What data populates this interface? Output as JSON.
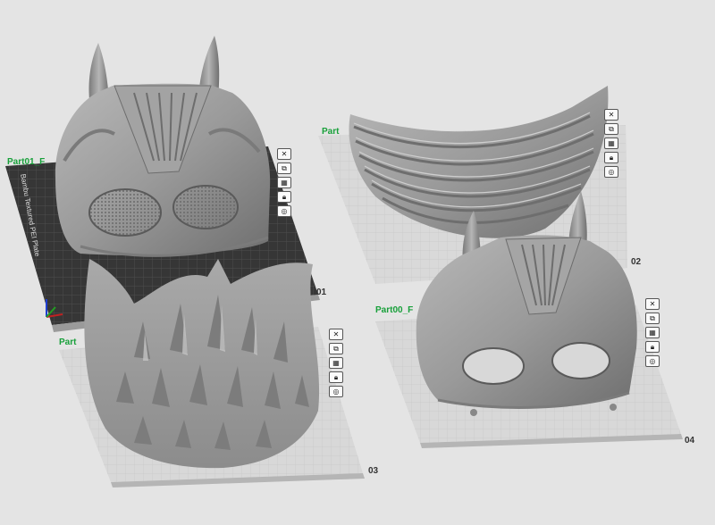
{
  "plates": [
    {
      "id": "plate-1",
      "label": "Part01_F",
      "number": "01",
      "side_text": "Bambu Textured PEI Plate",
      "icons": [
        "close-icon",
        "arrange-icon",
        "grid-icon",
        "lock-icon",
        "settings-icon"
      ]
    },
    {
      "id": "plate-2",
      "label": "Part",
      "number": "02",
      "icons": [
        "close-icon",
        "arrange-icon",
        "grid-icon",
        "lock-icon",
        "settings-icon"
      ]
    },
    {
      "id": "plate-3",
      "label": "Part",
      "number": "03",
      "icons": [
        "close-icon",
        "arrange-icon",
        "grid-icon",
        "lock-icon",
        "settings-icon"
      ]
    },
    {
      "id": "plate-4",
      "label": "Part00_F",
      "number": "04",
      "icons": [
        "close-icon",
        "arrange-icon",
        "grid-icon",
        "lock-icon",
        "settings-icon"
      ]
    }
  ],
  "glyphs": {
    "close-icon": "✕",
    "arrange-icon": "⧉",
    "grid-icon": "▦",
    "lock-icon": "🔒︎",
    "settings-icon": "◎"
  },
  "colors": {
    "background": "#e4e4e4",
    "plate_light": "#dadada",
    "plate_dark": "#3a3a3a",
    "label_green": "#18a03a",
    "model_gray": "#9a9a9a"
  }
}
